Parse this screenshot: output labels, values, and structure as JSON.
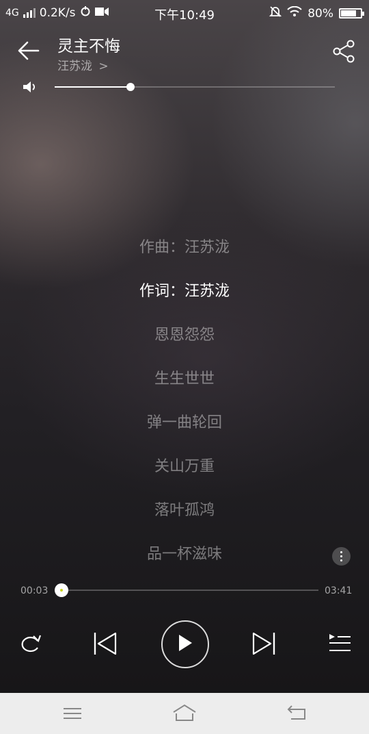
{
  "status_bar": {
    "network": "4G",
    "speed": "0.2K/s",
    "time": "下午10:49",
    "battery": "80%",
    "battery_level": 0.8
  },
  "song": {
    "title": "灵主不悔",
    "artist": "汪苏泷",
    "artist_chevron": ">"
  },
  "volume": {
    "level": 0.27
  },
  "lyrics": {
    "lines": [
      "作曲：汪苏泷",
      "作词：汪苏泷",
      "恩恩怨怨",
      "生生世世",
      "弹一曲轮回",
      "关山万重",
      "落叶孤鸿",
      "品一杯滋味"
    ],
    "active_index": 1
  },
  "progress": {
    "elapsed": "00:03",
    "total": "03:41",
    "fraction": 0.025
  },
  "icons": {
    "back": "arrow-left-icon",
    "share": "share-icon",
    "volume": "speaker-icon",
    "more": "more-vertical-icon",
    "repeat": "repeat-icon",
    "previous": "skip-previous-icon",
    "play": "play-icon",
    "next": "skip-next-icon",
    "playlist": "playlist-icon"
  },
  "colors": {
    "accent_dot": "#c9d21f",
    "nav_bar": "#ededed"
  }
}
